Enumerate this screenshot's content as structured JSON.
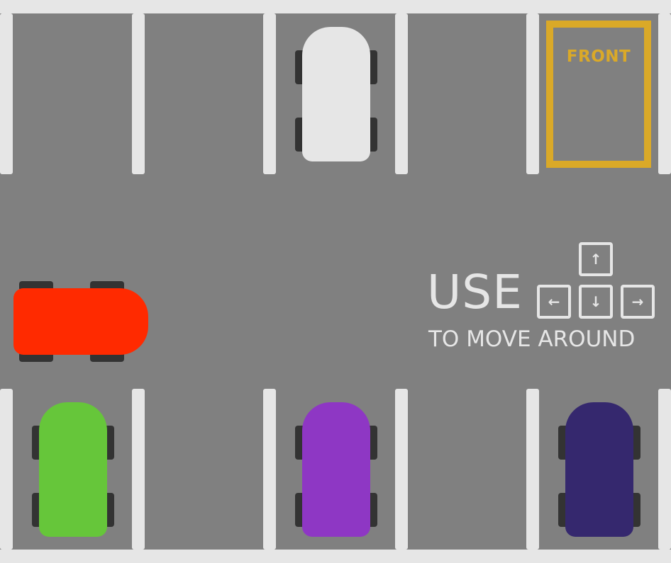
{
  "instructions": {
    "use_word": "USE",
    "move_text": "TO MOVE AROUND",
    "keys": {
      "up": "↑",
      "left": "←",
      "down": "↓",
      "right": "→"
    }
  },
  "target_spot": {
    "label": "FRONT",
    "color": "#daa928"
  },
  "player_car": {
    "color": "#ff2a00",
    "orientation": "facing-right"
  },
  "parked_cars": [
    {
      "name": "white-car",
      "color": "#e6e6e6",
      "row": "top"
    },
    {
      "name": "green-car",
      "color": "#66c63a",
      "row": "bottom"
    },
    {
      "name": "purple-car",
      "color": "#8e37c4",
      "row": "bottom"
    },
    {
      "name": "navy-car",
      "color": "#35286e",
      "row": "bottom"
    }
  ],
  "colors": {
    "asphalt": "#808080",
    "lines": "#e6e6e6",
    "wheels": "#333333"
  }
}
